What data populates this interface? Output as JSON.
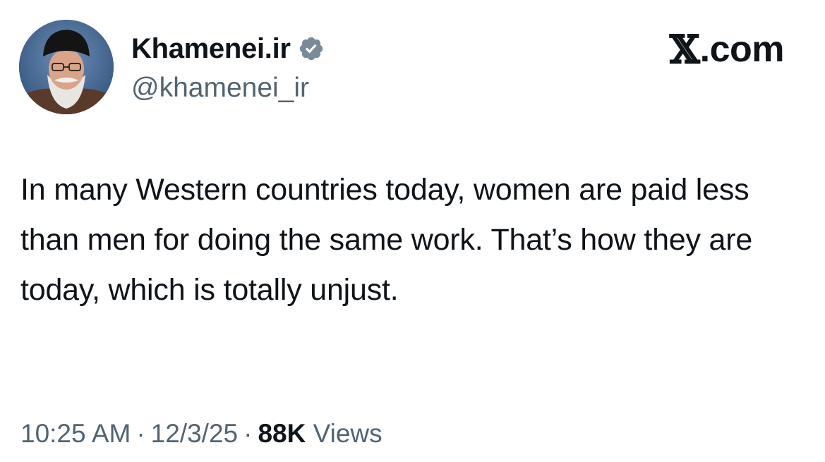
{
  "author": {
    "display_name": "Khamenei.ir",
    "handle": "@khamenei_ir",
    "verified_icon": "verified-badge-icon"
  },
  "brand": {
    "x_glyph": "𝕏",
    "suffix": ".com"
  },
  "tweet": {
    "text": "In many Western countries today, women are paid less than men for doing the same work. That’s how they are today, which is totally unjust."
  },
  "meta": {
    "time": "10:25 AM",
    "separator": "·",
    "date": "12/3/25",
    "views_count": "88K",
    "views_label": "Views"
  },
  "colors": {
    "text_primary": "#0f1419",
    "text_secondary": "#536471",
    "badge": "#7b8a99"
  }
}
